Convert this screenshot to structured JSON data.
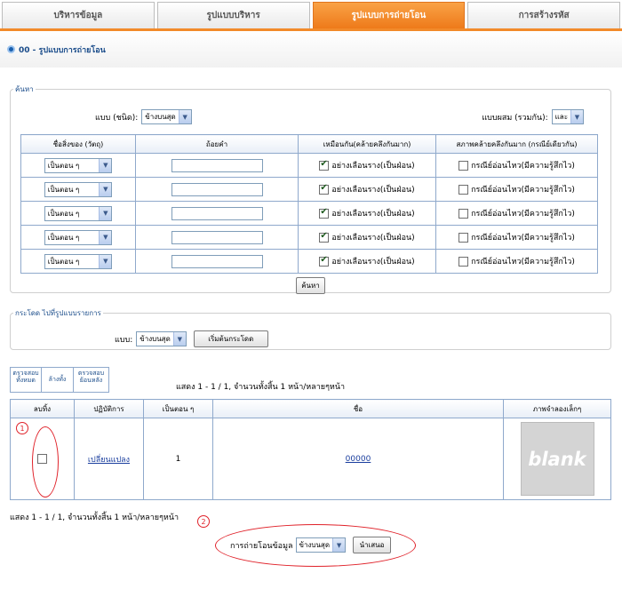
{
  "tabs": [
    {
      "label": "บริหารข้อมูล",
      "active": false
    },
    {
      "label": "รูปแบบบริหาร",
      "active": false
    },
    {
      "label": "รูปแบบการถ่ายโอน",
      "active": true
    },
    {
      "label": "การสร้างรหัส",
      "active": false
    }
  ],
  "page_title": "00 - รูปแบบการถ่ายโอน",
  "search": {
    "legend": "ค้นหา",
    "type_label": "แบบ (ชนิด):",
    "type_value": "ข้างบนสุด",
    "combine_label": "แบบผสม (รวมกัน):",
    "combine_value": "และ",
    "headers": [
      "ชื่อสิ่งของ (วัตถุ)",
      "ถ้อยคำ",
      "เหมือนกัน(คล้ายคลึงกันมาก)",
      "สภาพคล้ายคลึงกันมาก (กรณีย์เดียวกัน)"
    ],
    "rows": [
      {
        "field": "เป็นตอน ๆ",
        "similar_label": "อย่างเลือนราง(เป็นฝ่อน)",
        "similar_checked": true,
        "case_label": "กรณีย์อ่อนไหว(มีความรู้สึกไว)",
        "case_checked": false
      },
      {
        "field": "เป็นตอน ๆ",
        "similar_label": "อย่างเลือนราง(เป็นฝ่อน)",
        "similar_checked": true,
        "case_label": "กรณีย์อ่อนไหว(มีความรู้สึกไว)",
        "case_checked": false
      },
      {
        "field": "เป็นตอน ๆ",
        "similar_label": "อย่างเลือนราง(เป็นฝ่อน)",
        "similar_checked": true,
        "case_label": "กรณีย์อ่อนไหว(มีความรู้สึกไว)",
        "case_checked": false
      },
      {
        "field": "เป็นตอน ๆ",
        "similar_label": "อย่างเลือนราง(เป็นฝ่อน)",
        "similar_checked": true,
        "case_label": "กรณีย์อ่อนไหว(มีความรู้สึกไว)",
        "case_checked": false
      },
      {
        "field": "เป็นตอน ๆ",
        "similar_label": "อย่างเลือนราง(เป็นฝ่อน)",
        "similar_checked": true,
        "case_label": "กรณีย์อ่อนไหว(มีความรู้สึกไว)",
        "case_checked": false
      }
    ],
    "search_button": "ค้นหา"
  },
  "jump": {
    "legend": "กระโดด ไปที่รูปแบบรายการ",
    "label": "แบบ:",
    "value": "ข้างบนสุด",
    "button": "เริ่มต้นกระโดด"
  },
  "list_actions": {
    "check_all": "ตรวจสอบทั้งหมด",
    "clear_all": "ล้างทั้ง",
    "check_reverse": "ตรวจสอบย้อนหลัง"
  },
  "paging_text": "แสดง 1 - 1 / 1, จำนวนทั้งสิ้น 1 หน้า/หลายๆหน้า",
  "results": {
    "headers": [
      "ลบทิ้ง",
      "ปฏิบัติการ",
      "เป็นตอน ๆ",
      "ชื่อ",
      "ภาพจำลองเล็กๆ"
    ],
    "rows": [
      {
        "delete_checked": false,
        "action": "เปลี่ยนแปลง",
        "seq": "1",
        "name": "00000",
        "thumb": "blank"
      }
    ]
  },
  "paging_text_bottom": "แสดง 1 - 1 / 1, จำนวนทั้งสิ้น 1 หน้า/หลายๆหน้า",
  "transfer": {
    "label": "การถ่ายโอนข้อมูล",
    "value": "ข้างบนสุด",
    "button": "นำเสนอ"
  },
  "annotations": [
    "1",
    "2"
  ],
  "colors": {
    "accent": "#f28a2a",
    "link": "#1a3e9e",
    "highlight": "#e0222a"
  }
}
